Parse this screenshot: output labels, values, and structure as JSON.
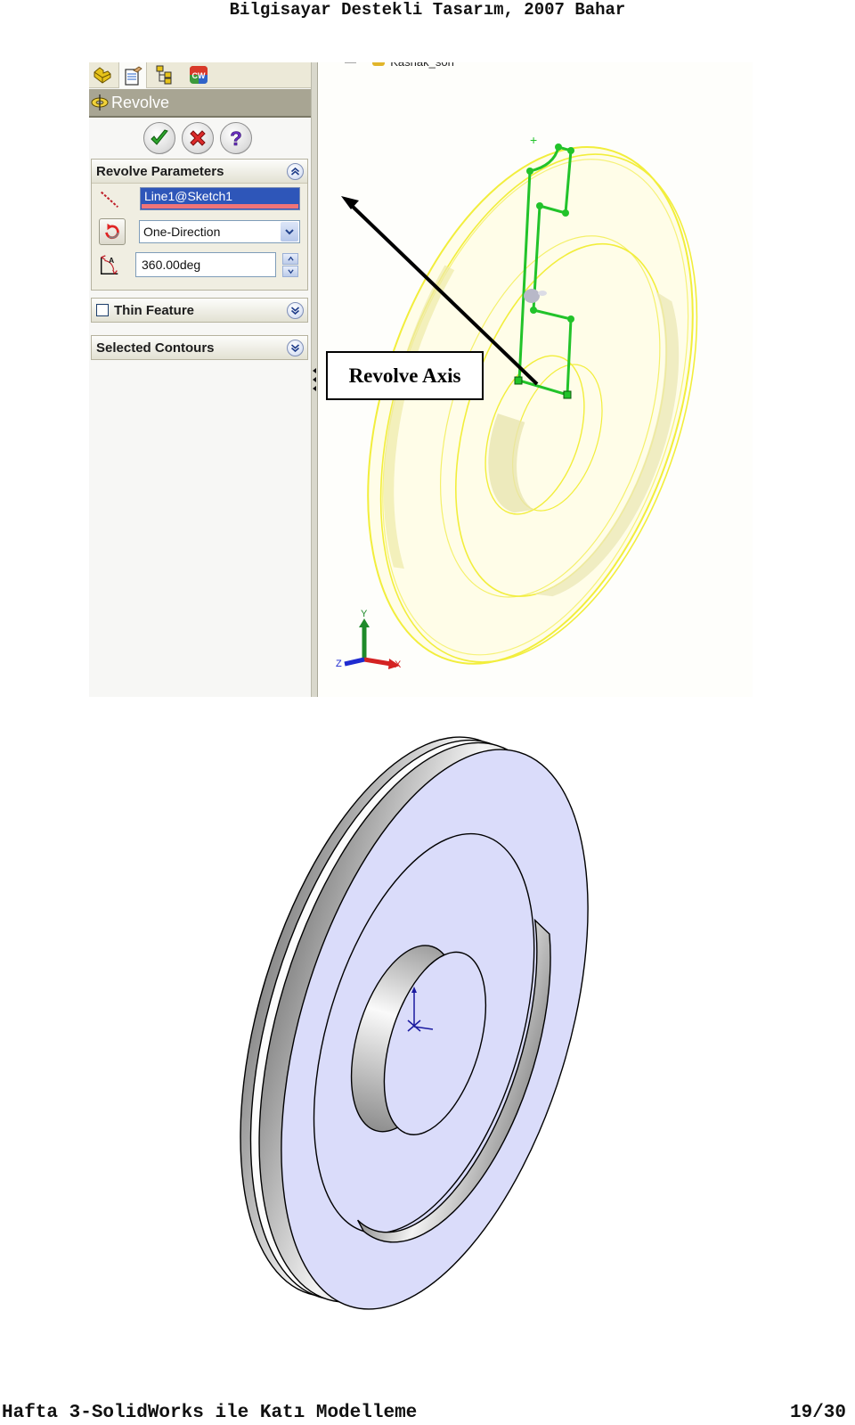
{
  "page": {
    "header": "Bilgisayar Destekli Tasarım, 2007 Bahar",
    "footer_left": "Hafta 3-SolidWorks ile Katı Modelleme",
    "footer_right": "19/30"
  },
  "property_manager": {
    "tabs": [
      {
        "name": "feature-manager-tab",
        "icon": "feature-tree-icon"
      },
      {
        "name": "property-manager-tab",
        "icon": "property-sheet-icon",
        "active": true
      },
      {
        "name": "configuration-manager-tab",
        "icon": "configuration-icon"
      },
      {
        "name": "appearance-tab",
        "icon": "cw-display-icon"
      }
    ],
    "feature_title": "Revolve",
    "buttons": {
      "ok": "OK",
      "cancel": "Cancel",
      "help": "Help"
    },
    "revolve_parameters": {
      "heading": "Revolve Parameters",
      "axis_value": "Line1@Sketch1",
      "direction_value": "One-Direction",
      "angle_value": "360.00deg"
    },
    "thin_feature": {
      "label": "Thin Feature",
      "checked": false
    },
    "selected_contours": {
      "label": "Selected Contours"
    }
  },
  "viewport": {
    "tree_item": "Kasnak_son",
    "triad": {
      "x": "X",
      "y": "Y",
      "z": "Z"
    },
    "colors": {
      "preview": "#f5f36a",
      "sketch": "#22c32a"
    }
  },
  "annotation": {
    "callout": "Revolve Axis"
  },
  "result_model": {
    "face_color": "#dadcfa"
  }
}
